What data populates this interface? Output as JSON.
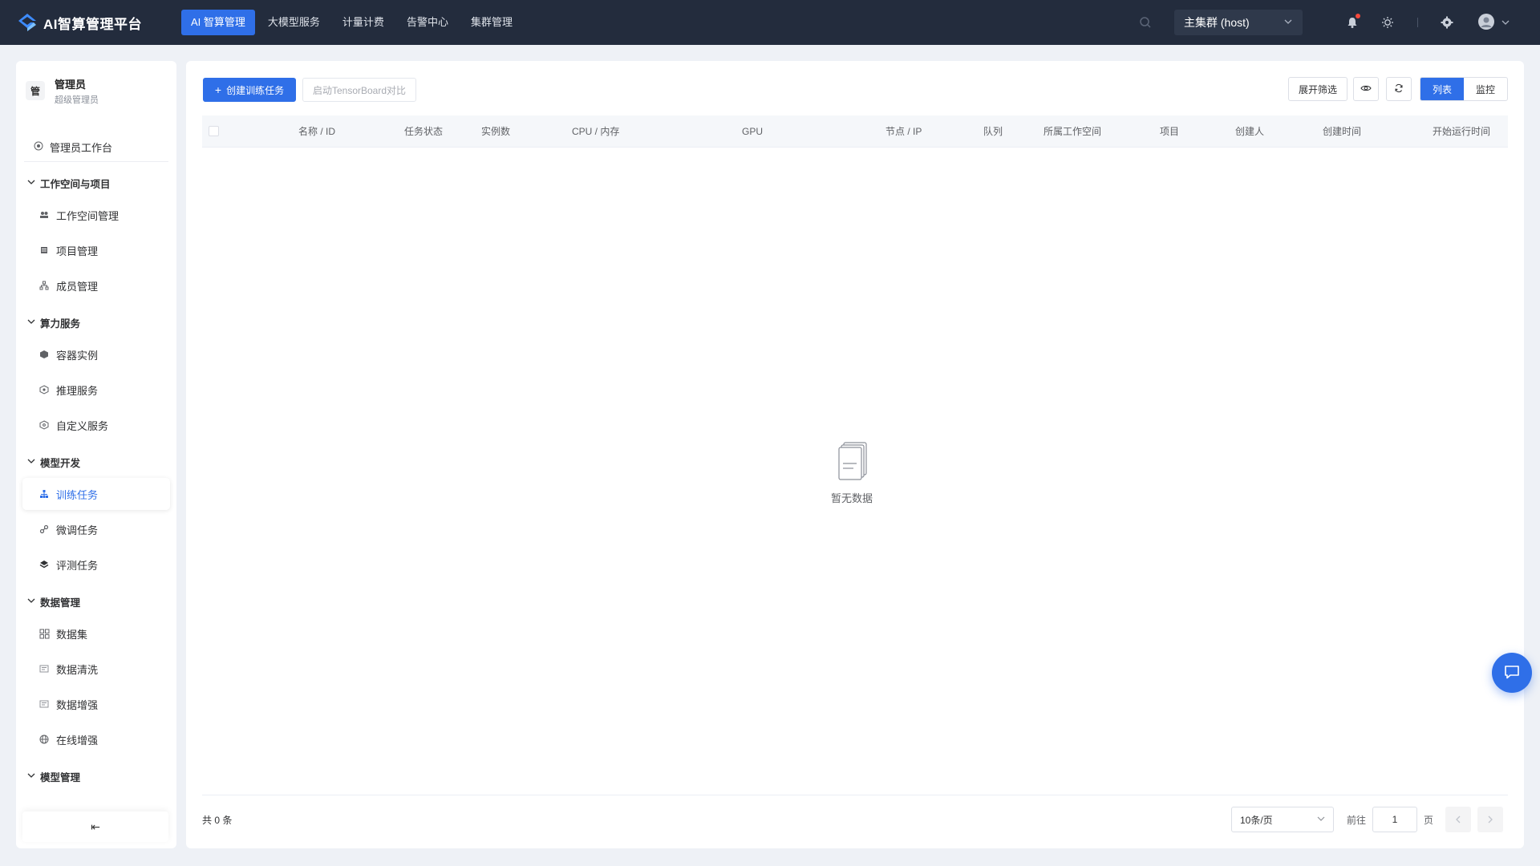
{
  "app": {
    "title": "AI智算管理平台",
    "accent": "#2f6fe8",
    "topbar_bg": "#232c3d"
  },
  "topnav": {
    "items": [
      "AI 智算管理",
      "大模型服务",
      "计量计费",
      "告警中心",
      "集群管理"
    ],
    "active_index": 0
  },
  "cluster": {
    "selected": "主集群 (host)"
  },
  "user": {
    "avatar_char": "管",
    "name": "管理员",
    "role": "超级管理员"
  },
  "sidebar": {
    "home": "管理员工作台",
    "groups": [
      {
        "title": "工作空间与项目",
        "items": [
          {
            "label": "工作空间管理",
            "icon": "users-icon"
          },
          {
            "label": "项目管理",
            "icon": "list-icon"
          },
          {
            "label": "成员管理",
            "icon": "org-icon"
          }
        ]
      },
      {
        "title": "算力服务",
        "items": [
          {
            "label": "容器实例",
            "icon": "cube-icon"
          },
          {
            "label": "推理服务",
            "icon": "hexagon-icon"
          },
          {
            "label": "自定义服务",
            "icon": "shield-icon"
          }
        ]
      },
      {
        "title": "模型开发",
        "items": [
          {
            "label": "训练任务",
            "icon": "tree-icon",
            "active": true
          },
          {
            "label": "微调任务",
            "icon": "link-icon"
          },
          {
            "label": "评测任务",
            "icon": "layers-icon"
          }
        ]
      },
      {
        "title": "数据管理",
        "items": [
          {
            "label": "数据集",
            "icon": "grid-icon"
          },
          {
            "label": "数据清洗",
            "icon": "doc-icon"
          },
          {
            "label": "数据增强",
            "icon": "doc-icon"
          },
          {
            "label": "在线增强",
            "icon": "globe-icon"
          }
        ]
      },
      {
        "title": "模型管理",
        "items": []
      }
    ],
    "collapse_label": "⇤"
  },
  "toolbar": {
    "create_label": "创建训练任务",
    "tensorboard_label": "启动TensorBoard对比",
    "filter_label": "展开筛选",
    "view_list": "列表",
    "view_monitor": "监控"
  },
  "table": {
    "columns": [
      "名称 / ID",
      "任务状态",
      "实例数",
      "CPU / 内存",
      "GPU",
      "节点 / IP",
      "队列",
      "所属工作空间",
      "项目",
      "创建人",
      "创建时间",
      "开始运行时间"
    ],
    "rows": [],
    "empty_text": "暂无数据"
  },
  "pagination": {
    "total_text": "共 0 条",
    "page_size": "10条/页",
    "goto_label": "前往",
    "page_value": "1",
    "page_unit": "页"
  }
}
